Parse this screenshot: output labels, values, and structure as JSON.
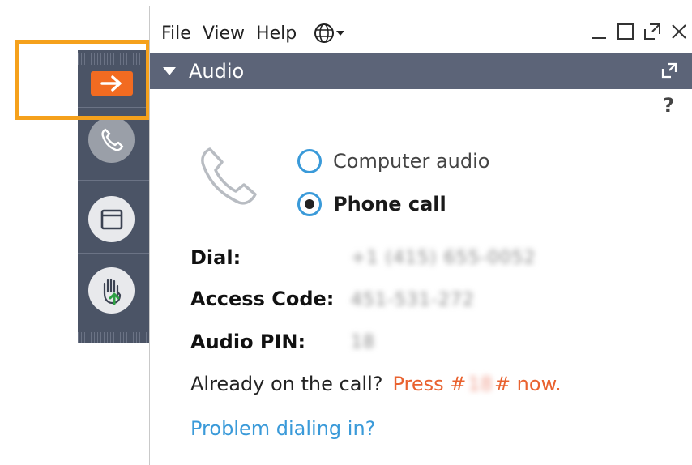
{
  "menu": {
    "file": "File",
    "view": "View",
    "help": "Help"
  },
  "panel": {
    "title": "Audio",
    "help_mark": "?"
  },
  "audio_options": [
    {
      "label": "Computer audio",
      "selected": false
    },
    {
      "label": "Phone call",
      "selected": true
    }
  ],
  "fields": [
    {
      "label": "Dial:",
      "value": "+1 (415) 655-0052"
    },
    {
      "label": "Access Code:",
      "value": "451-531-272"
    },
    {
      "label": "Audio PIN:",
      "value": "18"
    }
  ],
  "already_on_call": {
    "prompt": "Already on the call?",
    "press_prefix": "Press #",
    "pin": "18",
    "press_suffix": "# now."
  },
  "problem_link": "Problem dialing in?",
  "colors": {
    "accent_orange": "#f26b21",
    "highlight": "#f5a11c",
    "header_bg": "#5c6478",
    "link_blue": "#3a9ad9",
    "press_red": "#e9622f"
  },
  "icons": [
    "arrow-right-icon",
    "phone-icon",
    "screen-icon",
    "raise-hand-icon",
    "globe-icon",
    "minimize-icon",
    "maximize-icon",
    "popout-icon",
    "close-icon"
  ]
}
